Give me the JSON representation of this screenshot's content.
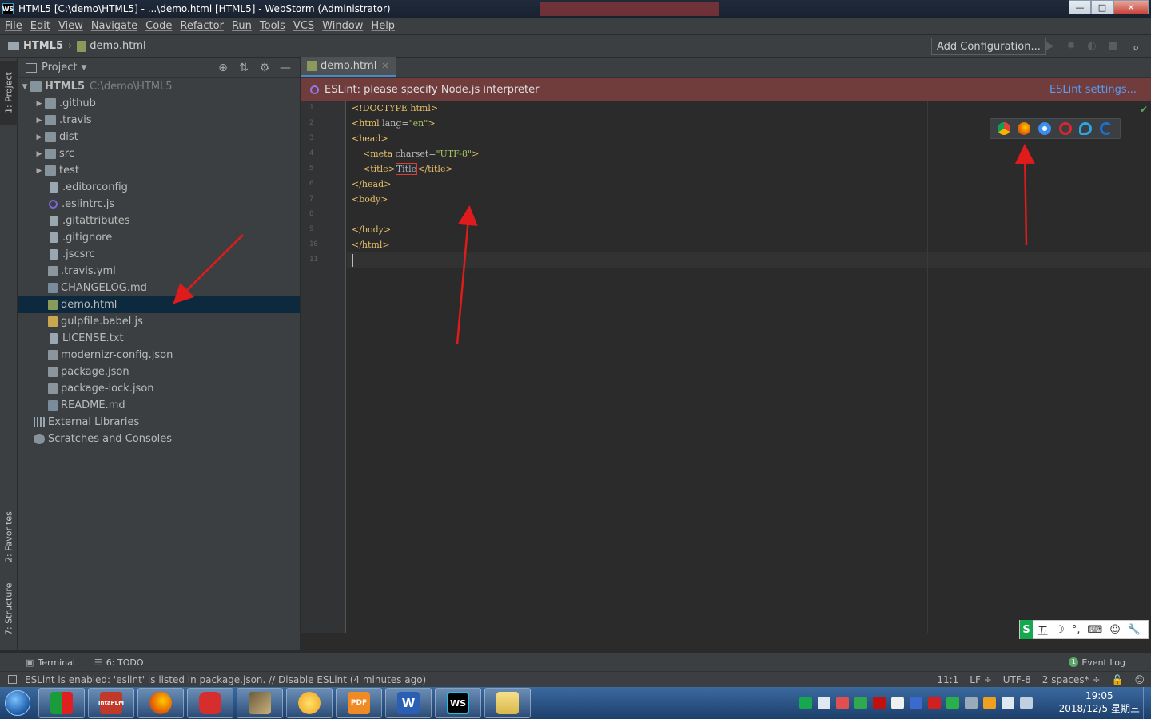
{
  "window": {
    "title": "HTML5 [C:\\demo\\HTML5] - ...\\demo.html [HTML5] - WebStorm (Administrator)",
    "logo": "WS",
    "buttons": {
      "minimize": "—",
      "maximize": "□",
      "close": "✕"
    }
  },
  "menu": [
    "File",
    "Edit",
    "View",
    "Navigate",
    "Code",
    "Refactor",
    "Run",
    "Tools",
    "VCS",
    "Window",
    "Help"
  ],
  "nav": {
    "project": "HTML5",
    "file": "demo.html",
    "add_configuration": "Add Configuration..."
  },
  "left_stripe": {
    "project_tab": "1: Project",
    "favorites_tab": "2: Favorites",
    "structure_tab": "7: Structure"
  },
  "project_panel": {
    "title": "Project",
    "root": {
      "name": "HTML5",
      "path": "C:\\demo\\HTML5"
    },
    "folders": [
      ".github",
      ".travis",
      "dist",
      "src",
      "test"
    ],
    "files": [
      {
        "name": ".editorconfig",
        "icon": "config"
      },
      {
        "name": ".eslintrc.js",
        "icon": "eslint"
      },
      {
        "name": ".gitattributes",
        "icon": "file"
      },
      {
        "name": ".gitignore",
        "icon": "file"
      },
      {
        "name": ".jscsrc",
        "icon": "file"
      },
      {
        "name": ".travis.yml",
        "icon": "yml"
      },
      {
        "name": "CHANGELOG.md",
        "icon": "md"
      },
      {
        "name": "demo.html",
        "icon": "html"
      },
      {
        "name": "gulpfile.babel.js",
        "icon": "js"
      },
      {
        "name": "LICENSE.txt",
        "icon": "file"
      },
      {
        "name": "modernizr-config.json",
        "icon": "json"
      },
      {
        "name": "package.json",
        "icon": "json"
      },
      {
        "name": "package-lock.json",
        "icon": "json"
      },
      {
        "name": "README.md",
        "icon": "md"
      }
    ],
    "external_libraries": "External Libraries",
    "scratches": "Scratches and Consoles",
    "selected": "demo.html"
  },
  "editor": {
    "tab": "demo.html",
    "eslint_message": "ESLint: please specify Node.js interpreter",
    "eslint_settings": "ESLint settings...",
    "line_numbers": [
      "1",
      "2",
      "3",
      "4",
      "5",
      "6",
      "7",
      "8",
      "9",
      "10",
      "11"
    ],
    "code": {
      "l1": "<!DOCTYPE html>",
      "l2_tag_open": "<html ",
      "l2_attr": "lang=",
      "l2_val": "\"en\"",
      "l2_close": ">",
      "l3": "<head>",
      "l4_tag": "<meta ",
      "l4_attr": "charset=",
      "l4_val": "\"UTF-8\"",
      "l4_close": ">",
      "l5_open": "<title>",
      "l5_text": "Title",
      "l5_close": "</title>",
      "l6": "</head>",
      "l7": "<body>",
      "l9": "</body>",
      "l10": "</html>"
    },
    "browser_icons": [
      "chrome-icon",
      "firefox-icon",
      "safari-icon",
      "opera-icon",
      "ie-icon",
      "edge-icon"
    ]
  },
  "bottom": {
    "terminal": "Terminal",
    "todo": "6: TODO",
    "event_log": "Event Log",
    "event_count": "1"
  },
  "status": {
    "message": "ESLint is enabled: 'eslint' is listed in package.json. // Disable ESLint (4 minutes ago)",
    "position": "11:1",
    "line_sep": "LF ÷",
    "encoding": "UTF-8",
    "indent": "2 spaces* ÷"
  },
  "ime": {
    "logo": "S",
    "mode": "五",
    "items": [
      "☽",
      "°,",
      "⌨",
      "☺",
      "🔧"
    ]
  },
  "taskbar": {
    "apps": [
      {
        "name": "app-icon",
        "label": ""
      },
      {
        "name": "intaplm-icon",
        "label": "IntaPLM"
      },
      {
        "name": "firefox-icon",
        "label": ""
      },
      {
        "name": "car-icon",
        "label": ""
      },
      {
        "name": "book-icon",
        "label": ""
      },
      {
        "name": "qq-icon",
        "label": ""
      },
      {
        "name": "pdf-icon",
        "label": "PDF"
      },
      {
        "name": "word-icon",
        "label": "W"
      },
      {
        "name": "webstorm-icon",
        "label": "WS"
      },
      {
        "name": "explorer-icon",
        "label": ""
      }
    ],
    "time": "19:05",
    "date": "2018/12/5 星期三"
  },
  "colors": {
    "accent": "#4a88c7",
    "eslint_bar": "#703c3c",
    "selection": "#0d293e",
    "arrow": "#e01b1b"
  }
}
